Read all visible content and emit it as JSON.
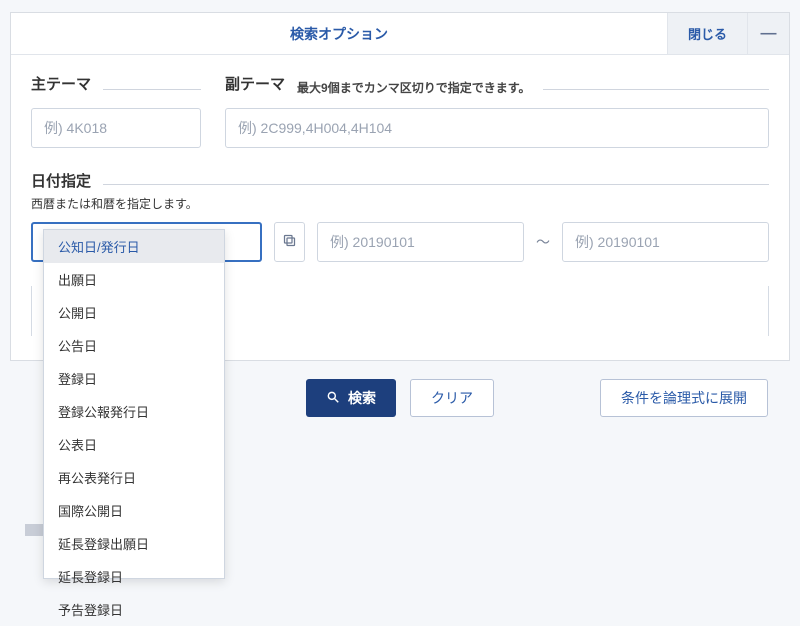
{
  "panel": {
    "title": "検索オプション",
    "close_label": "閉じる",
    "collapse_glyph": "—"
  },
  "theme": {
    "main_label": "主テーマ",
    "sub_label": "副テーマ",
    "sub_note": "最大9個までカンマ区切りで指定できます。",
    "main_placeholder": "例) 4K018",
    "sub_placeholder": "例) 2C999,4H004,4H104"
  },
  "date": {
    "section_label": "日付指定",
    "note": "西暦または和暦を指定します。",
    "from_placeholder": "例) 20190101",
    "to_placeholder": "例) 20190101",
    "range_sep": "〜",
    "options": [
      "公知日/発行日",
      "出願日",
      "公開日",
      "公告日",
      "登録日",
      "登録公報発行日",
      "公表日",
      "再公表発行日",
      "国際公開日",
      "延長登録出願日",
      "延長登録日",
      "予告登録日"
    ],
    "highlighted_index": 0
  },
  "actions": {
    "search_label": "検索",
    "clear_label": "クリア",
    "expand_label": "条件を論理式に展開"
  }
}
